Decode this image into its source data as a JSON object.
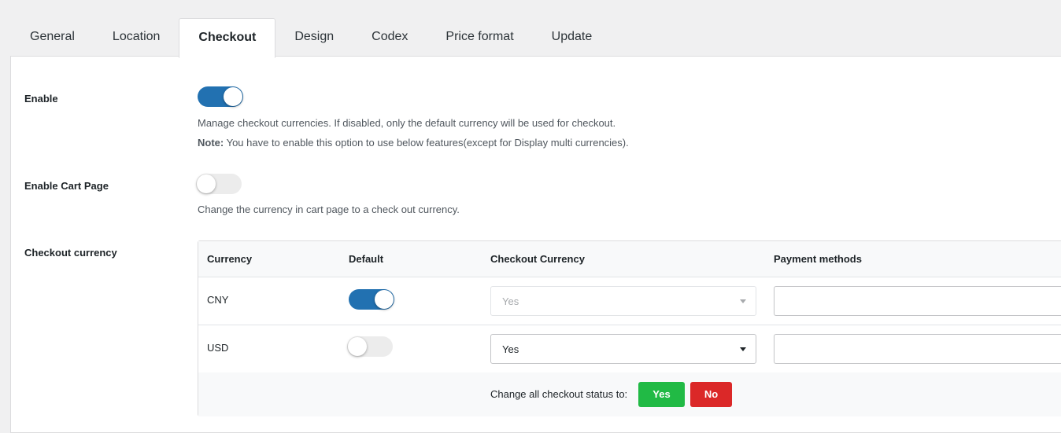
{
  "tabs": [
    {
      "label": "General",
      "active": false
    },
    {
      "label": "Location",
      "active": false
    },
    {
      "label": "Checkout",
      "active": true
    },
    {
      "label": "Design",
      "active": false
    },
    {
      "label": "Codex",
      "active": false
    },
    {
      "label": "Price format",
      "active": false
    },
    {
      "label": "Update",
      "active": false
    }
  ],
  "enable": {
    "label": "Enable",
    "on": true,
    "desc": "Manage checkout currencies. If disabled, only the default currency will be used for checkout.",
    "note_label": "Note:",
    "note_text": " You have to enable this option to use below features(except for Display multi currencies)."
  },
  "cart_page": {
    "label": "Enable Cart Page",
    "on": false,
    "desc": "Change the currency in cart page to a check out currency."
  },
  "checkout_currency": {
    "label": "Checkout currency",
    "columns": [
      "Currency",
      "Default",
      "Checkout Currency",
      "Payment methods"
    ],
    "rows": [
      {
        "currency": "CNY",
        "default_on": true,
        "checkout": "Yes",
        "checkout_disabled": true,
        "payment": ""
      },
      {
        "currency": "USD",
        "default_on": false,
        "checkout": "Yes",
        "checkout_disabled": false,
        "payment": ""
      }
    ],
    "footer_label": "Change all checkout status to:",
    "yes_label": "Yes",
    "no_label": "No"
  },
  "colors": {
    "accent": "#2271b1",
    "yes_button": "#21ba45",
    "no_button": "#db2828"
  }
}
